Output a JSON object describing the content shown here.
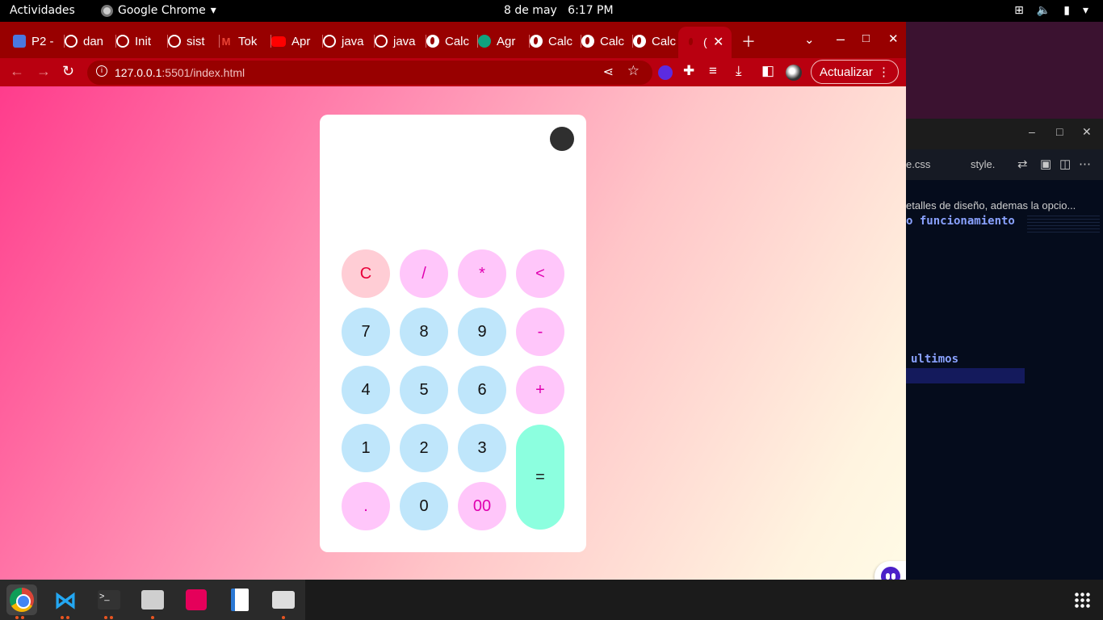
{
  "topbar": {
    "activities": "Actividades",
    "app_name": "Google Chrome",
    "clock_date": "8 de may",
    "clock_time": "6:17 PM"
  },
  "browser": {
    "tabs": [
      {
        "label": "P2 -",
        "icon": "people-icon"
      },
      {
        "label": "dan",
        "icon": "github-icon"
      },
      {
        "label": "Init",
        "icon": "github-icon"
      },
      {
        "label": "sist",
        "icon": "github-icon"
      },
      {
        "label": "Tok",
        "icon": "gmail-icon"
      },
      {
        "label": "Apr",
        "icon": "youtube-icon"
      },
      {
        "label": "java",
        "icon": "github-icon"
      },
      {
        "label": "java",
        "icon": "github-icon"
      },
      {
        "label": "Calc",
        "icon": "globe-icon"
      },
      {
        "label": "Agr",
        "icon": "chatgpt-icon"
      },
      {
        "label": "Calc",
        "icon": "globe-icon"
      },
      {
        "label": "Calc",
        "icon": "globe-icon"
      },
      {
        "label": "Calc",
        "icon": "globe-icon"
      }
    ],
    "active_tab_label": "(",
    "url_host": "127.0.0.1",
    "url_rest": ":5501/index.html",
    "update_label": "Actualizar",
    "theme_color": "#b90010"
  },
  "calculator": {
    "display": "",
    "keys": {
      "clear": "C",
      "divide": "/",
      "multiply": "*",
      "backspace": "<",
      "seven": "7",
      "eight": "8",
      "nine": "9",
      "minus": "-",
      "four": "4",
      "five": "5",
      "six": "6",
      "plus": "+",
      "one": "1",
      "two": "2",
      "three": "3",
      "equals": "=",
      "dot": ".",
      "zero": "0",
      "double_zero": "00"
    },
    "colors": {
      "number_key": "#bfe6fb",
      "operator_key": "#ffc6fa",
      "clear_key": "#ffcdd5",
      "equals_key": "#8cffdf"
    }
  },
  "vscode": {
    "tab1": "e.css",
    "tab2": "style.",
    "breadcrumb": "etalles de diseño, ademas la opcio...",
    "code_line1": "o funcionamiento",
    "code_line2": "ultimos"
  }
}
